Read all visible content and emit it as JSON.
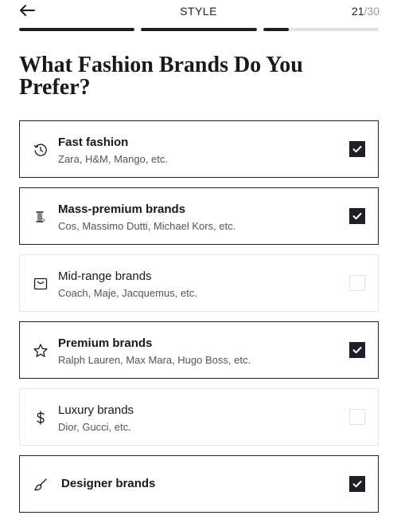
{
  "header": {
    "title": "STYLE",
    "step_current": "21",
    "step_total": "/30"
  },
  "progress": {
    "segments": [
      1.0,
      1.0,
      0.22
    ]
  },
  "question": {
    "title": "What Fashion Brands Do You Prefer?"
  },
  "options": [
    {
      "label": "Fast fashion",
      "sub": "Zara, H&M, Mango, etc.",
      "icon": "clock-icon",
      "selected": true
    },
    {
      "label": "Mass-premium brands",
      "sub": "Cos, Massimo Dutti, Michael Kors, etc.",
      "icon": "thread-spool-icon",
      "selected": true
    },
    {
      "label": "Mid-range brands",
      "sub": "Coach, Maje, Jacquemus, etc.",
      "icon": "bag-icon",
      "selected": false
    },
    {
      "label": "Premium brands",
      "sub": "Ralph Lauren, Max Mara, Hugo Boss, etc.",
      "icon": "star-icon",
      "selected": true
    },
    {
      "label": "Luxury brands",
      "sub": "Dior, Gucci, etc.",
      "icon": "dollar-icon",
      "selected": false
    },
    {
      "label": "Designer brands",
      "sub": "",
      "icon": "brush-icon",
      "selected": true
    }
  ],
  "colors": {
    "checked": "#1f1f28",
    "progress_fill": "#1d1d1d",
    "progress_track": "#e3e3e3"
  }
}
